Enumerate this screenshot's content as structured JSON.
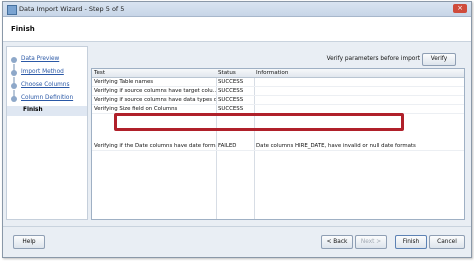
{
  "window": {
    "title": "Data Import Wizard - Step 5 of 5",
    "close_glyph": "×"
  },
  "header": {
    "title": "Finish"
  },
  "nav": {
    "items": [
      {
        "label": "Data Preview"
      },
      {
        "label": "Import Method"
      },
      {
        "label": "Choose Columns"
      },
      {
        "label": "Column Definition"
      },
      {
        "label": "Finish"
      }
    ]
  },
  "verify": {
    "label": "Verify parameters before import",
    "button": "Verify"
  },
  "table": {
    "headers": [
      "Test",
      "Status",
      "Information"
    ],
    "rows": [
      {
        "test": "Verifying Table names",
        "status": "SUCCESS",
        "info": ""
      },
      {
        "test": "Verifying if source columns have target colu...",
        "status": "SUCCESS",
        "info": ""
      },
      {
        "test": "Verifying if source columns have data types d...",
        "status": "SUCCESS",
        "info": ""
      },
      {
        "test": "Verifying Size field on Columns",
        "status": "SUCCESS",
        "info": ""
      },
      {
        "test": "Verifying if the Date columns have date formats",
        "status": "FAILED",
        "info": "Date columns HIRE_DATE,  have invalid or null date formats"
      }
    ]
  },
  "footer": {
    "help": "Help",
    "back": "< Back",
    "next": "Next >",
    "finish": "Finish",
    "cancel": "Cancel"
  },
  "colors": {
    "highlight": "#b0202a",
    "link": "#2a58a6"
  }
}
